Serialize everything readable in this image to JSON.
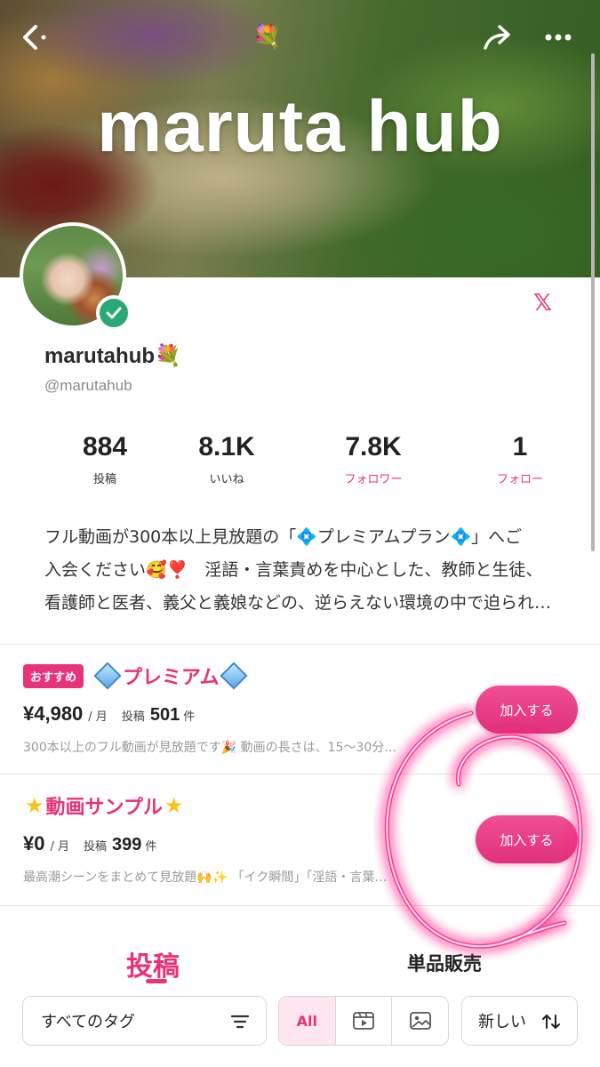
{
  "banner": {
    "title": "maruta hub"
  },
  "profile": {
    "display_name": "marutahub💐",
    "handle": "@marutahub",
    "x_icon_label": "𝕏"
  },
  "stats": [
    {
      "value": "884",
      "label": "投稿"
    },
    {
      "value": "8.1K",
      "label": "いいね"
    },
    {
      "value": "7.8K",
      "label": "フォロワー"
    },
    {
      "value": "1",
      "label": "フォロー"
    }
  ],
  "bio": {
    "line1": "フル動画が300本以上見放題の「💠プレミアムプラン💠」へご",
    "line2": "入会ください🥰❣️　淫語・言葉責めを中心とした、教師と生徒、",
    "line3": "看護師と医者、義父と義娘などの、逆らえない環境の中で迫られ…"
  },
  "plans": [
    {
      "badge": "おすすめ",
      "title": "プレミアム",
      "price": "¥4,980",
      "per": "/ 月",
      "posts_label": "投稿",
      "posts_count": "501",
      "posts_unit": "件",
      "description": "300本以上のフル動画が見放題です🎉 動画の長さは、15〜30分…",
      "join_label": "加入する"
    },
    {
      "title": "動画サンプル",
      "price": "¥0",
      "per": "/ 月",
      "posts_label": "投稿",
      "posts_count": "399",
      "posts_unit": "件",
      "description": "最高潮シーンをまとめて見放題🙌✨ 「イク瞬間」「淫語・言葉…",
      "join_label": "加入する"
    }
  ],
  "tabs": {
    "posts": "投稿",
    "single_sale": "単品販売"
  },
  "filters": {
    "tag_select": "すべてのタグ",
    "all_label": "All",
    "sort_label": "新しい"
  },
  "colors": {
    "accent": "#e8337a",
    "verified": "#2aa876"
  },
  "icons": [
    "back-icon",
    "share-icon",
    "more-icon",
    "verified-check-icon",
    "x-logo-icon",
    "filter-icon",
    "video-icon",
    "image-icon",
    "sort-icon"
  ]
}
